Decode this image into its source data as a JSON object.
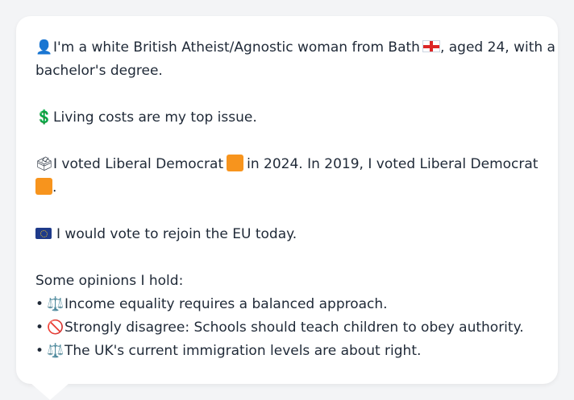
{
  "profile": {
    "intro_line1": "I'm a white British Atheist/Agnostic woman from Bath",
    "intro_line1_end": ", aged 24, with a",
    "intro_line2": "bachelor's degree.",
    "issue": "Living costs are my top issue.",
    "vote_part1": "I voted Liberal Democrat",
    "vote_part2": "in 2024. In 2019, I voted Liberal Democrat",
    "vote_end": ".",
    "eu": "I would vote to rejoin the EU today.",
    "opinions_header": "Some opinions I hold:",
    "opinions": [
      {
        "icon": "balance-scale-icon",
        "text": "Income equality requires a balanced approach."
      },
      {
        "icon": "prohibited-icon",
        "text": "Strongly disagree: Schools should teach children to obey authority."
      },
      {
        "icon": "balance-scale-icon",
        "text": "The UK's current immigration levels are about right."
      }
    ]
  },
  "colors": {
    "party_liberal_democrat": "#f7941d",
    "background": "#f3f4f6",
    "card": "#ffffff"
  }
}
